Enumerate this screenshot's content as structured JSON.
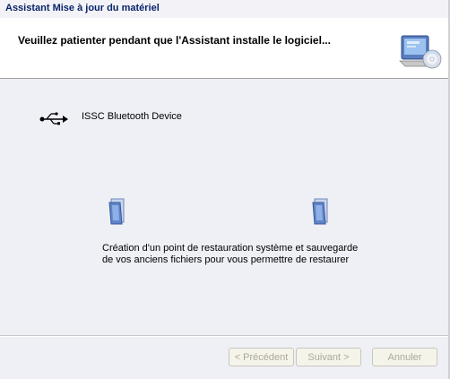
{
  "window": {
    "title": "Assistant Mise à jour du matériel"
  },
  "header": {
    "headline": "Veuillez patienter pendant que l'Assistant installe le logiciel...",
    "icon": "hardware-cd-icon"
  },
  "content": {
    "device_icon": "usb-icon",
    "device_name": "ISSC Bluetooth Device",
    "folder_icon": "folder-icon",
    "status_line1": "Création d'un point de restauration système et sauvegarde",
    "status_line2": "de vos anciens fichiers pour vous permettre de restaurer"
  },
  "buttons": {
    "prev": "< Précédent",
    "next": "Suivant >",
    "cancel": "Annuler"
  },
  "colors": {
    "title_text": "#0a246a",
    "content_bg": "#eff0f6",
    "disabled_text": "#aca899"
  }
}
